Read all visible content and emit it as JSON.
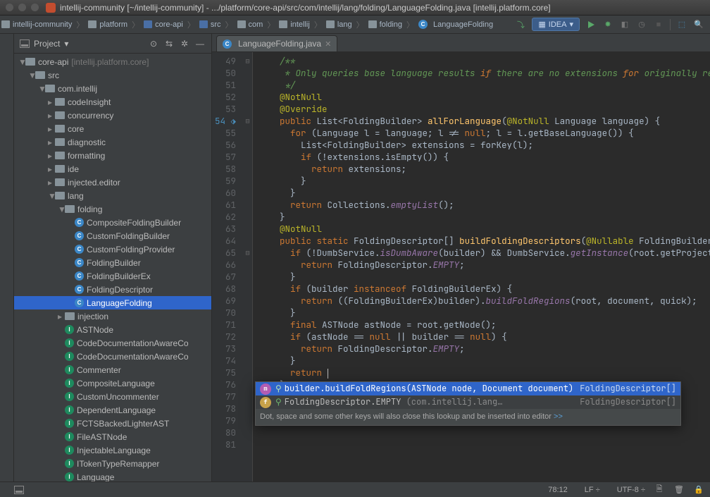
{
  "titlebar": {
    "title": "intellij-community [~/intellij-community] - .../platform/core-api/src/com/intellij/lang/folding/LanguageFolding.java [intellij.platform.core]"
  },
  "breadcrumbs": [
    {
      "icon": "folder",
      "label": "intellij-community"
    },
    {
      "icon": "folder",
      "label": "platform"
    },
    {
      "icon": "folder-blue",
      "label": "core-api"
    },
    {
      "icon": "folder-blue",
      "label": "src"
    },
    {
      "icon": "folder",
      "label": "com"
    },
    {
      "icon": "folder",
      "label": "intellij"
    },
    {
      "icon": "folder",
      "label": "lang"
    },
    {
      "icon": "folder",
      "label": "folding"
    },
    {
      "icon": "class",
      "label": "LanguageFolding"
    }
  ],
  "runConfig": "IDEA",
  "project": {
    "label": "Project",
    "root": {
      "name": "core-api",
      "hint": "[intellij.platform.core]"
    },
    "srcPkg": "com.intellij",
    "folders": [
      "codeInsight",
      "concurrency",
      "core",
      "diagnostic",
      "formatting",
      "ide",
      "injected.editor",
      "lang"
    ],
    "folding": {
      "name": "folding",
      "items": [
        "CompositeFoldingBuilder",
        "CustomFoldingBuilder",
        "CustomFoldingProvider",
        "FoldingBuilder",
        "FoldingBuilderEx",
        "FoldingDescriptor",
        "LanguageFolding"
      ],
      "selected": "LanguageFolding"
    },
    "afterFolding": [
      "injection"
    ],
    "interfaces": [
      "ASTNode",
      "CodeDocumentationAwareCo",
      "CodeDocumentationAwareCo",
      "Commenter",
      "CompositeLanguage",
      "CustomUncommenter",
      "DependentLanguage",
      "FCTSBackedLighterAST",
      "FileASTNode",
      "InjectableLanguage",
      "ITokenTypeRemapper",
      "Language"
    ]
  },
  "tab": {
    "file": "LanguageFolding.java"
  },
  "code": {
    "start": 49,
    "lines": [
      "    /**",
      "     * Only queries base language results if there are no extensions for originally requested",
      "     */",
      "    @NotNull",
      "    @Override",
      "    public List<FoldingBuilder> allForLanguage(@NotNull Language language) {",
      "      for (Language l = language; l != null; l = l.getBaseLanguage()) {",
      "        List<FoldingBuilder> extensions = forKey(l);",
      "        if (!extensions.isEmpty()) {",
      "          return extensions;",
      "        }",
      "      }",
      "      return Collections.emptyList();",
      "    }",
      "",
      "    @NotNull",
      "    public static FoldingDescriptor[] buildFoldingDescriptors(@Nullable FoldingBuilder builder",
      "      if (!DumbService.isDumbAware(builder) && DumbService.getInstance(root.getProject()).isDum",
      "        return FoldingDescriptor.EMPTY;",
      "      }",
      "",
      "      if (builder instanceof FoldingBuilderEx) {",
      "        return ((FoldingBuilderEx)builder).buildFoldRegions(root, document, quick);",
      "      }",
      "      final ASTNode astNode = root.getNode();",
      "      if (astNode == null || builder == null) {",
      "        return FoldingDescriptor.EMPTY;",
      "      }",
      "",
      "      return ",
      "    }",
      "  }",
      ""
    ]
  },
  "completion": {
    "items": [
      {
        "icon": "m-pink",
        "sig": "builder.buildFoldRegions(ASTNode node, Document document)",
        "ret": "FoldingDescriptor[]",
        "selected": true
      },
      {
        "icon": "f-yellow",
        "sig": "FoldingDescriptor.EMPTY",
        "pkg": "(com.intellij.lang…",
        "ret": "FoldingDescriptor[]",
        "selected": false
      }
    ],
    "tip": "Dot, space and some other keys will also close this lookup and be inserted into editor",
    "tipLink": ">>"
  },
  "status": {
    "pos": "78:12",
    "lf": "LF",
    "enc": "UTF-8"
  }
}
